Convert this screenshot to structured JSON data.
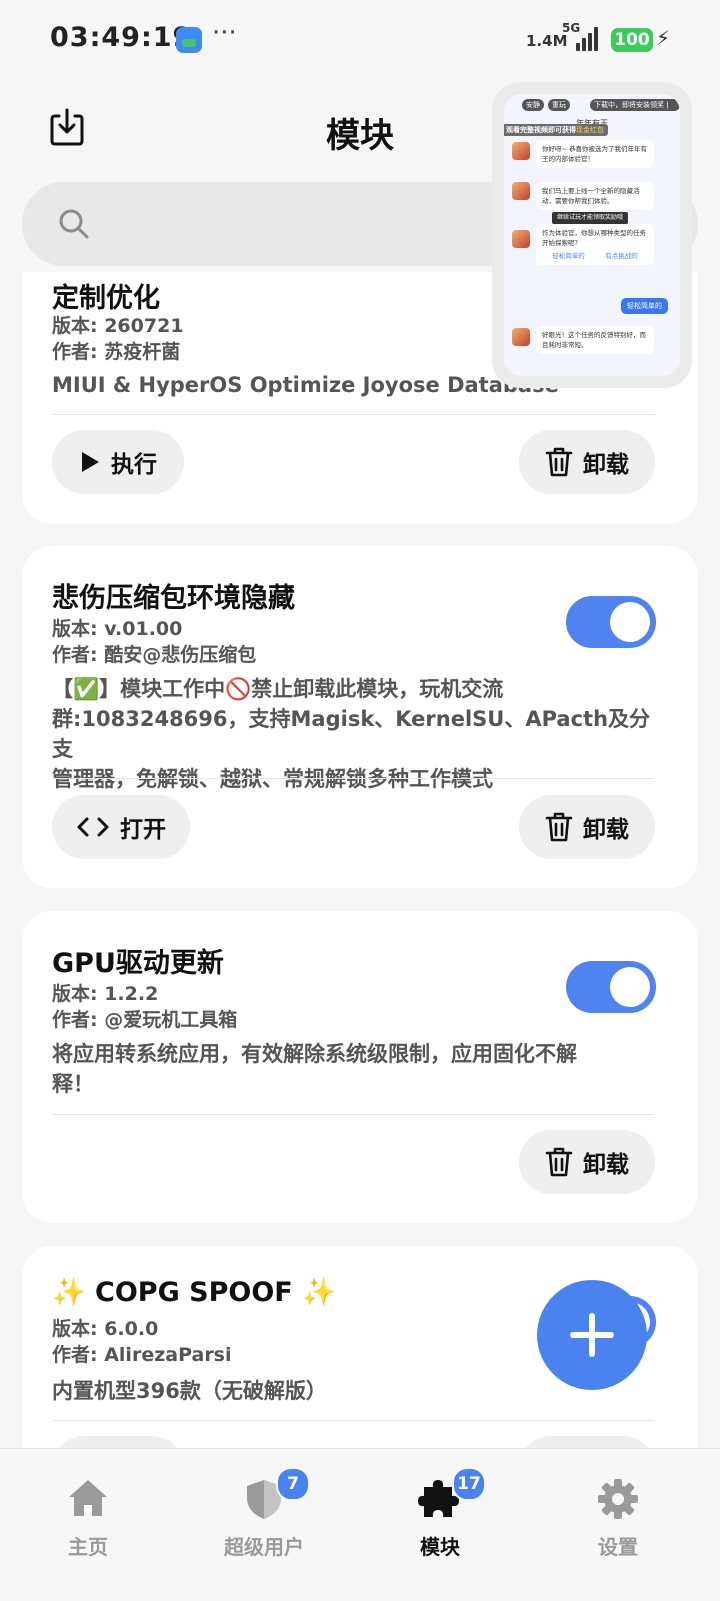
{
  "status_bar": {
    "time": "03:49:19",
    "more": "···",
    "net_speed": "1.4M",
    "network_type": "5G",
    "battery": "100"
  },
  "header": {
    "title": "模块"
  },
  "pip_video": {
    "chips": [
      "安静",
      "重玩",
      "下载中，即将安装领奖 | 跳过"
    ],
    "banner_prefix": "观看完整视频即可获得",
    "banner_highlight": "现金红包",
    "chat_name": "年年有王",
    "messages": [
      "你好呀~ 恭喜你被选为了我们年年有王的内部体验官！",
      "我们马上要上线一个全新的隐藏活动，需要你帮我们体验。",
      "作为体验官，你想从哪种类型的任务开始探索呢？",
      "好眼光！这个任务的反馈特别好，而且耗时非常短。"
    ],
    "options": [
      "轻松简单的",
      "有点挑战的"
    ],
    "reply": "轻松简单的",
    "tip": "继续试玩才能领取奖励哦"
  },
  "modules": [
    {
      "title": "定制优化",
      "version": "版本: 260721",
      "author": "作者: 苏疫杆菌",
      "description": "MIUI & HyperOS Optimize Joyose Database",
      "action_label": "执行",
      "uninstall_label": "卸载"
    },
    {
      "title": "悲伤压缩包环境隐藏",
      "version": "版本: v.01.00",
      "author": "作者: 酷安@悲伤压缩包",
      "description_lines": [
        "【✅】模块工作中🚫禁止卸载此模块，玩机交流",
        "群:1083248696，支持Magisk、KernelSU、APacth及分支",
        "管理器，免解锁、越狱、常规解锁多种工作模式"
      ],
      "enabled": true,
      "action_label": "打开",
      "uninstall_label": "卸载"
    },
    {
      "title": "GPU驱动更新",
      "version": "版本: 1.2.2",
      "author": "作者: @爱玩机工具箱",
      "description_lines": [
        "将应用转系统应用，有效解除系统级限制，应用固化不解",
        "释！"
      ],
      "enabled": true,
      "uninstall_label": "卸载"
    },
    {
      "title": "✨ COPG SPOOF ✨",
      "version": "版本: 6.0.0",
      "author": "作者: AlirezaParsi",
      "description": "内置机型396款（无破解版）",
      "enabled": true
    }
  ],
  "bottom_nav": [
    {
      "label": "主页",
      "icon": "home-icon"
    },
    {
      "label": "超级用户",
      "icon": "shield-icon",
      "badge": "7"
    },
    {
      "label": "模块",
      "icon": "puzzle-icon",
      "badge": "17",
      "active": true
    },
    {
      "label": "设置",
      "icon": "gear-icon"
    }
  ],
  "colors": {
    "accent": "#4a82ef",
    "battery": "#3ccc5a",
    "card": "#ffffff",
    "background": "#f6f6f6"
  }
}
